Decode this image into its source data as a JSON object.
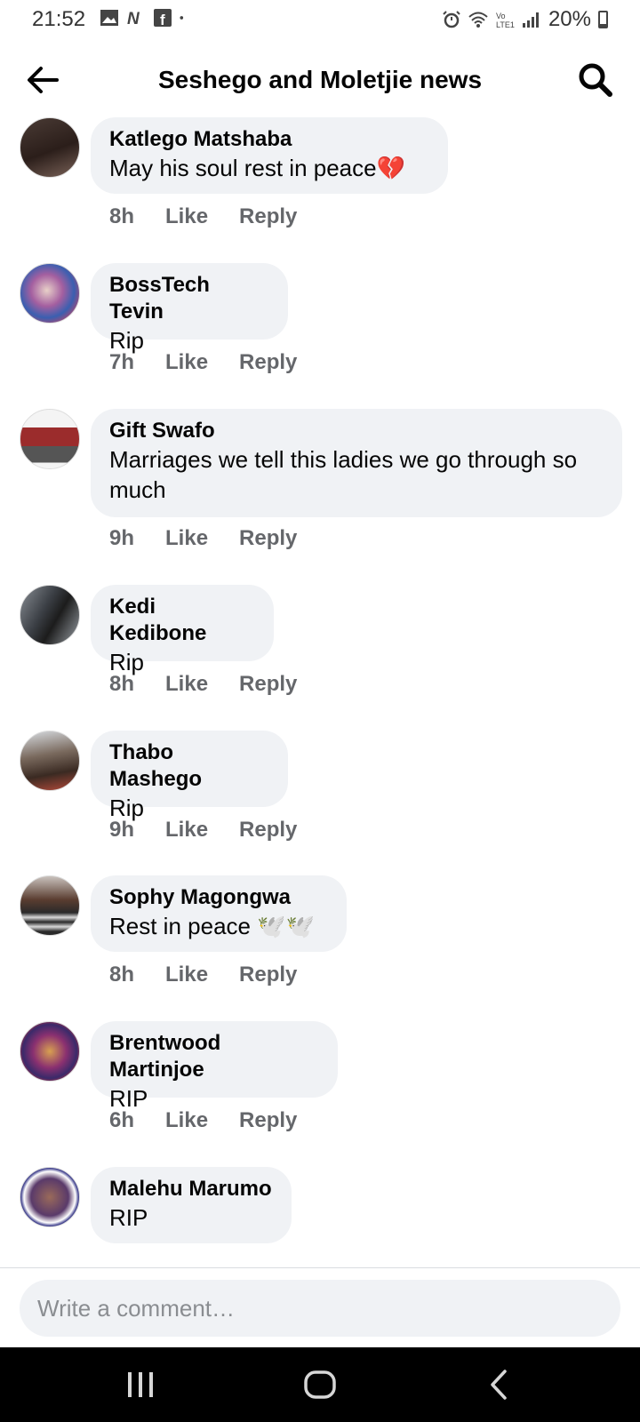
{
  "status_bar": {
    "time": "21:52",
    "battery": "20%",
    "icons": [
      "gallery-icon",
      "n-app-icon",
      "facebook-icon",
      "dot-icon",
      "alarm-icon",
      "wifi-icon",
      "volte-icon",
      "signal-icon",
      "battery-icon"
    ]
  },
  "header": {
    "title": "Seshego and Moletjie news",
    "back_icon": "arrow-left-icon",
    "search_icon": "search-icon"
  },
  "comments": [
    {
      "author": "Katlego Matshaba",
      "text": "May his soul rest in peace💔",
      "time": "8h",
      "like": "Like",
      "reply": "Reply"
    },
    {
      "author": "BossTech Tevin",
      "text": "Rip",
      "time": "7h",
      "like": "Like",
      "reply": "Reply"
    },
    {
      "author": "Gift Swafo",
      "text": "Marriages we tell this ladies we go through so much",
      "time": "9h",
      "like": "Like",
      "reply": "Reply"
    },
    {
      "author": "Kedi Kedibone",
      "text": "Rip",
      "time": "8h",
      "like": "Like",
      "reply": "Reply"
    },
    {
      "author": "Thabo Mashego",
      "text": "Rip",
      "time": "9h",
      "like": "Like",
      "reply": "Reply"
    },
    {
      "author": "Sophy Magongwa",
      "text": "Rest in peace 🕊️🕊️",
      "time": "8h",
      "like": "Like",
      "reply": "Reply"
    },
    {
      "author": "Brentwood Martinjoe",
      "text": "RIP",
      "time": "6h",
      "like": "Like",
      "reply": "Reply"
    },
    {
      "author": "Malehu Marumo",
      "text": "RIP",
      "time": "",
      "like": "",
      "reply": ""
    }
  ],
  "composer": {
    "placeholder": "Write a comment…"
  },
  "nav_bar": {
    "icons": [
      "recent-apps-icon",
      "home-icon",
      "back-icon"
    ]
  }
}
